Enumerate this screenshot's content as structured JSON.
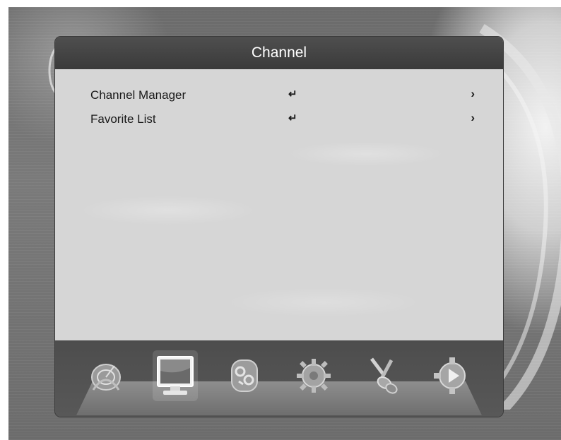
{
  "header": {
    "title": "Channel"
  },
  "menu": {
    "items": [
      {
        "label": "Channel Manager",
        "enter_symbol": "↵",
        "arrow": "›"
      },
      {
        "label": "Favorite List",
        "enter_symbol": "↵",
        "arrow": "›"
      }
    ]
  },
  "dock": {
    "selected_index": 1,
    "icons": [
      "satellite-dish-icon",
      "tv-monitor-icon",
      "letters-icon",
      "gear-icon",
      "av-cable-icon",
      "media-play-icon"
    ]
  }
}
